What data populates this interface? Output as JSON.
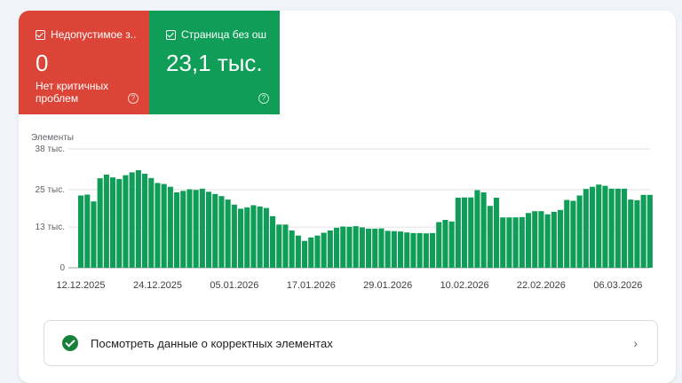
{
  "tiles": {
    "invalid": {
      "title": "Недопустимое з...",
      "value": "0",
      "subtitle": "Нет критичных проблем",
      "help": "?",
      "checked": true,
      "color": "#db4437"
    },
    "valid": {
      "title": "Страница без ош...",
      "value": "23,1 тыс.",
      "help": "?",
      "checked": true,
      "color": "#0f9d58"
    }
  },
  "chart_data": {
    "type": "bar",
    "ylabel": "Элементы",
    "ylim": [
      0,
      38
    ],
    "yticks": [
      {
        "value": 0,
        "label": "0"
      },
      {
        "value": 13,
        "label": "13 тыс."
      },
      {
        "value": 25,
        "label": "25 тыс."
      },
      {
        "value": 38,
        "label": "38 тыс."
      }
    ],
    "xticks": [
      "12.12.2025",
      "24.12.2025",
      "05.01.2026",
      "17.01.2026",
      "29.01.2026",
      "10.02.2026",
      "22.02.2026",
      "06.03.2026"
    ],
    "xtick_index": [
      0,
      12,
      24,
      36,
      48,
      60,
      72,
      84
    ],
    "bar_color": "#0f9d58",
    "grid": true,
    "values": [
      23.1,
      23.4,
      21.2,
      28.6,
      29.8,
      28.9,
      28.4,
      29.6,
      30.5,
      31.2,
      30.1,
      28.7,
      27.1,
      26.8,
      25.9,
      24.1,
      24.6,
      25.1,
      24.9,
      25.3,
      24.3,
      23.6,
      22.9,
      21.8,
      20.2,
      18.9,
      19.3,
      20.0,
      19.6,
      19.1,
      16.5,
      13.8,
      13.8,
      11.9,
      10.3,
      8.6,
      9.7,
      10.3,
      11.2,
      11.9,
      12.8,
      13.2,
      13.1,
      13.3,
      12.9,
      12.5,
      12.5,
      12.6,
      11.8,
      11.7,
      11.6,
      11.3,
      11.1,
      11.1,
      11.0,
      11.1,
      14.6,
      15.3,
      14.8,
      22.4,
      22.5,
      22.5,
      24.8,
      24.1,
      19.8,
      22.4,
      16.1,
      16.1,
      16.1,
      16.2,
      17.5,
      18.1,
      18.1,
      17.1,
      17.9,
      18.5,
      21.7,
      21.4,
      23.1,
      25.2,
      25.9,
      26.6,
      26.2,
      25.3,
      25.3,
      25.3,
      21.8,
      21.6,
      23.3,
      23.3
    ]
  },
  "action": {
    "label": "Посмотреть данные о корректных элементах",
    "chevron": "›"
  }
}
